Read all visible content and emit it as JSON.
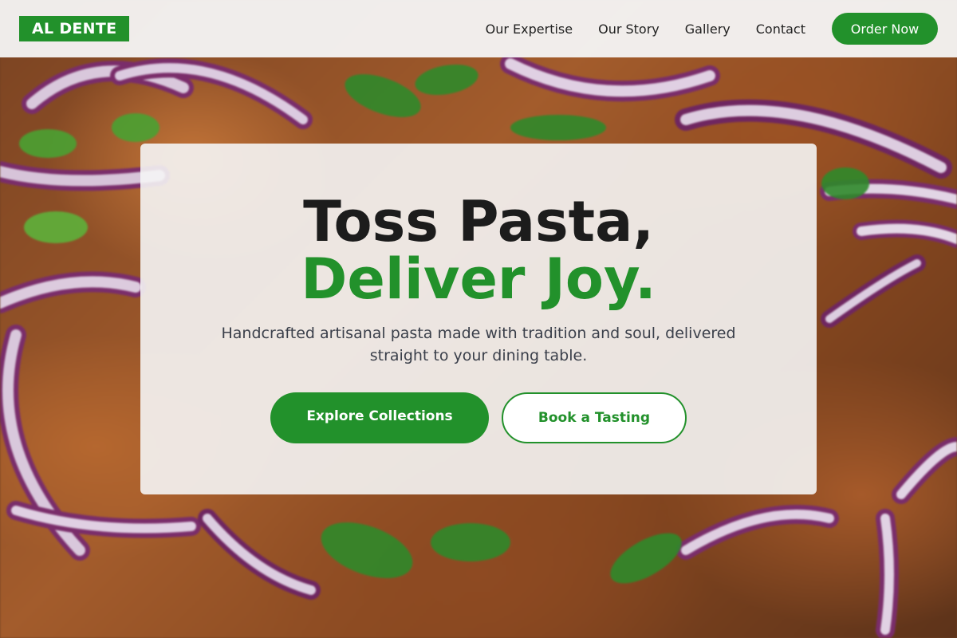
{
  "brand": {
    "logo_text": "AL DENTE",
    "accent": "#22912b"
  },
  "nav": {
    "links": [
      "Our Expertise",
      "Our Story",
      "Gallery",
      "Contact"
    ],
    "cta_label": "Order Now"
  },
  "hero": {
    "headline_line1": "Toss Pasta,",
    "headline_line2": "Deliver Joy.",
    "subtitle": "Handcrafted artisanal pasta made with tradition and soul, delivered straight to your dining table.",
    "primary_button": "Explore Collections",
    "secondary_button": "Book a Tasting"
  }
}
